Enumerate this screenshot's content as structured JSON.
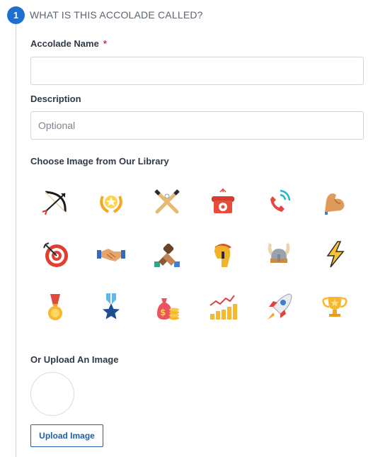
{
  "step": {
    "number": "1",
    "title": "WHAT IS THIS ACCOLADE CALLED?"
  },
  "name_field": {
    "label": "Accolade Name",
    "required_mark": "*",
    "value": "",
    "placeholder": ""
  },
  "description_field": {
    "label": "Description",
    "value": "",
    "placeholder": "Optional"
  },
  "library": {
    "label": "Choose Image from Our Library",
    "icons": [
      "bow-and-arrow-icon",
      "laurel-star-icon",
      "crossed-bats-icon",
      "red-telephone-icon",
      "ringing-phone-icon",
      "flexed-bicep-icon",
      "target-bullseye-icon",
      "handshake-icon",
      "fist-bump-icon",
      "spartan-helmet-icon",
      "viking-helmet-icon",
      "lightning-bolt-icon",
      "gold-medal-icon",
      "blue-star-medal-icon",
      "money-bag-icon",
      "growth-chart-icon",
      "rocket-icon",
      "trophy-icon"
    ]
  },
  "upload": {
    "label": "Or Upload An Image",
    "button_label": "Upload Image"
  },
  "colors": {
    "accent": "#1f6fd1",
    "required": "#d0245a",
    "button_border": "#1f5faa"
  }
}
